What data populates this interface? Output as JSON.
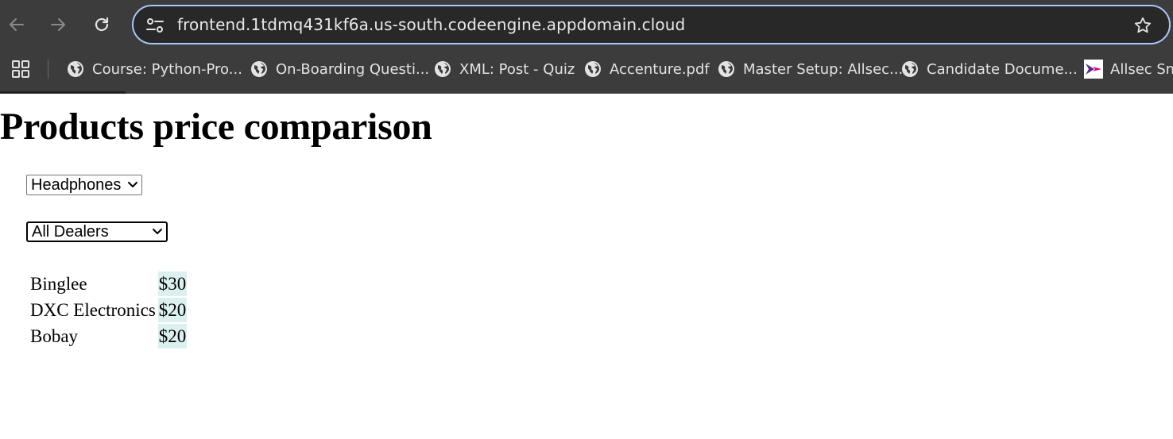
{
  "browser": {
    "url": "frontend.1tdmq431kf6a.us-south.codeengine.appdomain.cloud",
    "bookmarks": [
      {
        "label": "Course: Python-Pro...",
        "icon": "globe-icon"
      },
      {
        "label": "On-Boarding Questi...",
        "icon": "globe-icon"
      },
      {
        "label": "XML: Post - Quiz",
        "icon": "globe-icon"
      },
      {
        "label": "Accenture.pdf",
        "icon": "globe-icon"
      },
      {
        "label": "Master Setup: Allsec...",
        "icon": "globe-icon"
      },
      {
        "label": "Candidate Docume...",
        "icon": "globe-icon"
      },
      {
        "label": "Allsec Sma",
        "icon": "allsec-logo-icon"
      }
    ]
  },
  "page": {
    "title": "Products price comparison",
    "product_select": {
      "selected": "Headphones"
    },
    "dealer_select": {
      "selected": "All Dealers"
    },
    "prices": [
      {
        "dealer": "Binglee",
        "price": "$30"
      },
      {
        "dealer": "DXC Electronics",
        "price": "$20"
      },
      {
        "dealer": "Bobay",
        "price": "$20"
      }
    ]
  },
  "colors": {
    "chrome_bg": "#3c3c3c",
    "omnibox_border": "#a8c7fa",
    "price_cell_bg": "#dcf0f0"
  }
}
